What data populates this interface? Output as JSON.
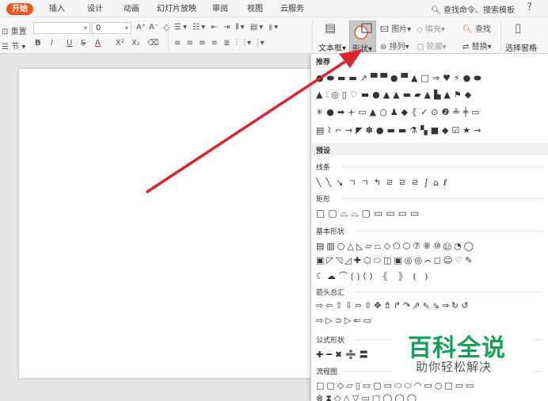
{
  "menubar": {
    "tabs": [
      {
        "label": "开始",
        "active": true
      },
      {
        "label": "插入"
      },
      {
        "label": "设计"
      },
      {
        "label": "动画"
      },
      {
        "label": "幻灯片放映"
      },
      {
        "label": "审阅"
      },
      {
        "label": "视图"
      },
      {
        "label": "云服务"
      }
    ],
    "search_label": "查找命令、搜索模板",
    "help": "?"
  },
  "ribbon": {
    "reset_label": "重置",
    "section_label": "节",
    "font_name_value": "",
    "font_size_value": "0",
    "font_grow": "A⁺",
    "font_shrink": "A⁻",
    "format_buttons": [
      "B",
      "I",
      "U",
      "S",
      "A",
      "X²",
      "X₂"
    ],
    "textbox_label": "文本框",
    "shape_label": "形状",
    "picture_label": "图片",
    "fill_label": "填充",
    "arrange_label": "排列",
    "outline_label": "轮廓",
    "find_label": "查找",
    "replace_label": "替换",
    "select_pane_label": "选择窗格"
  },
  "panel": {
    "recommended_title": "推荐",
    "preset_title": "预设",
    "sections": {
      "lines": "线条",
      "rect": "矩形",
      "basic": "基本形状",
      "arrows": "箭头总汇",
      "formula": "公式形状",
      "flowchart": "流程图"
    },
    "rows": {
      "rec1": "●⬬▬▬↗▀▀●▀▲□⇒♥⚡●⬬",
      "rec2": "▲⫶◎▯♡▬●▲▲▬▰▲▙▲⚑◆",
      "rec3": "✳●➡+▭▲○♟◆⦃✓⊙❷≗╪▭",
      "rec4": "▤⌇⌐→◤✽●▬▬⚗▚■◆☑★→",
      "lines": "╲╲↘ㄱㄱ↰ㄹㄹㄹ∫⌂ℓ",
      "rect": "□▢⌓⌓▢▭▭▭▭",
      "basic1": "▤▥○△◺▱⏢◇⬠⬡⑦⑧⑩⑫◔◯",
      "basic2": "▣◸◹◿✚⬡⬭◫▣◎◎⌒◻☺♡✎",
      "basic3": "☾☁⌒⟮⟯⟨⟩ ⦃ ⦄ ⦅ ⦆",
      "arrows1": "⇨⇦⇧⇩⬄⇳✥⇯↱↷⇗⇖⇘⇒↻↺",
      "arrows2": "⇨▷⊃▷⇐▭",
      "formula": "✚━✖➗〓",
      "flow1": "□▢◇▱▯▭▢▭⬭⬭◠▭○□▭▭",
      "flow2": "⊗⧗◇△▽▭□◯◯◯"
    }
  },
  "watermark": {
    "title": "百科全说",
    "subtitle": "助你轻松解决"
  },
  "colors": {
    "accent": "#e8581a",
    "shape_outline": "#4a7ec0",
    "arrow": "#d9252b",
    "watermark_green": "#18a05a"
  }
}
